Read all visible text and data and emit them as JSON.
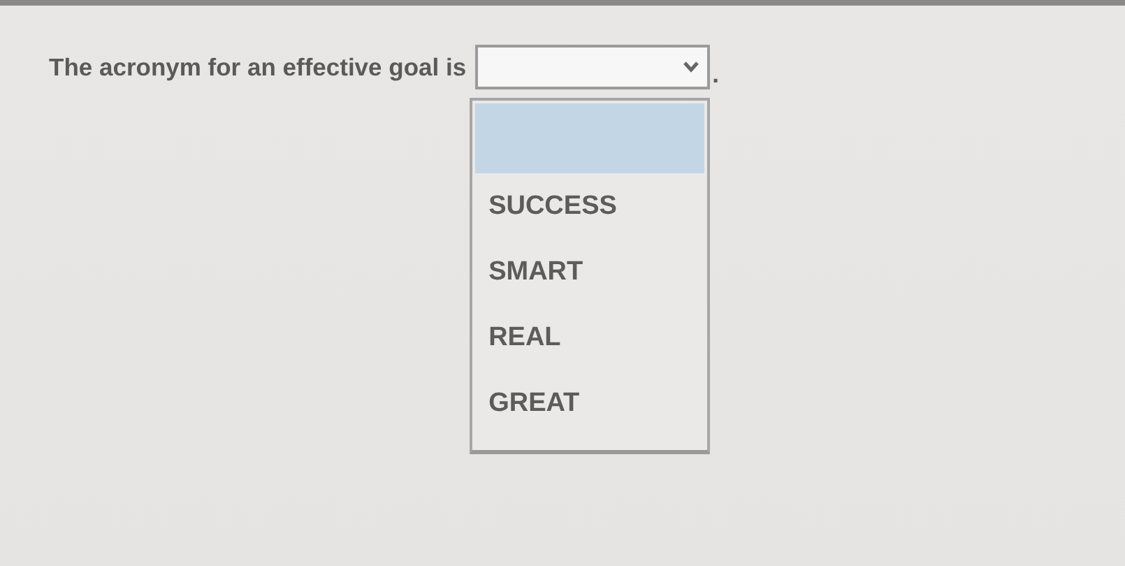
{
  "prompt": "The acronym for an effective goal is",
  "dropdown": {
    "expanded": true,
    "options": [
      {
        "selected": true
      },
      {
        "label": "SUCCESS",
        "selected": false
      },
      {
        "label": "SMART",
        "selected": false
      },
      {
        "label": "REAL",
        "selected": false
      },
      {
        "label": "GREAT",
        "selected": false
      }
    ]
  },
  "suffix": "."
}
